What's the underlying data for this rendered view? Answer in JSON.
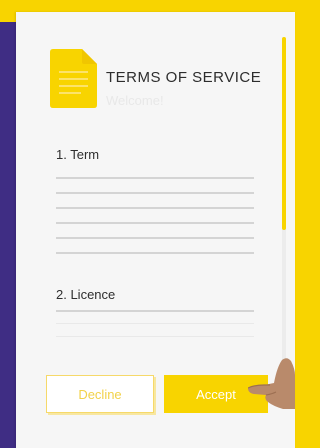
{
  "window": {
    "title": "TERMS OF SERVICE",
    "subtitle": "Welcome!"
  },
  "sections": [
    {
      "heading": "1. Term"
    },
    {
      "heading": "2. Licence"
    }
  ],
  "buttons": {
    "decline_label": "Decline",
    "accept_label": "Accept"
  },
  "colors": {
    "accent": "#f8d400",
    "side_panel": "#3f2d84",
    "card": "#f6f6f6"
  },
  "icons": {
    "document": "document-icon",
    "hand": "pointing-hand-icon"
  },
  "scroll_position": 0.0
}
